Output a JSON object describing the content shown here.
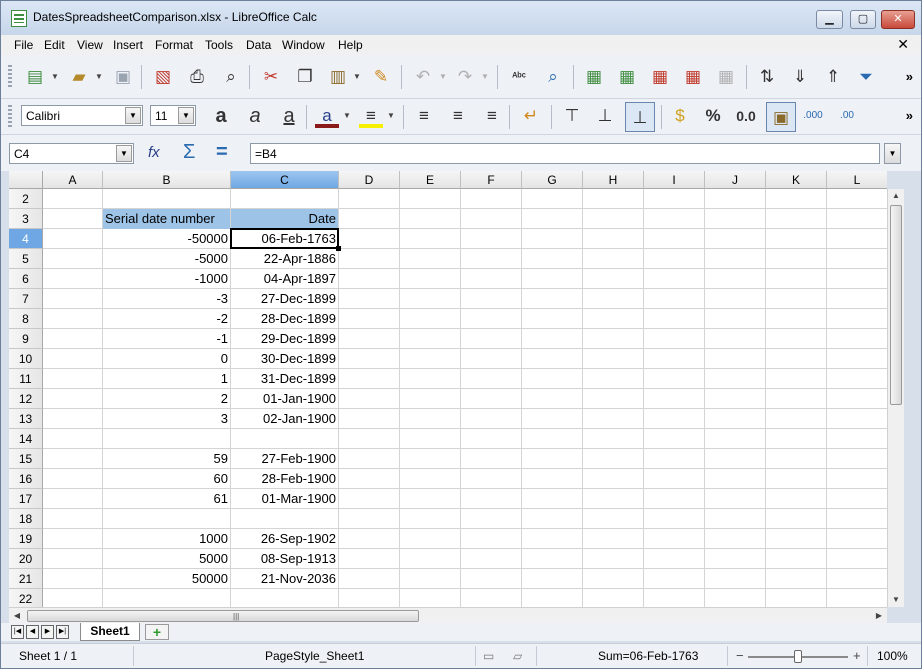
{
  "window": {
    "title": "DatesSpreadsheetComparison.xlsx - LibreOffice Calc",
    "minimize": "▁",
    "maximize": "▢",
    "close": "✕"
  },
  "menu": [
    "File",
    "Edit",
    "View",
    "Insert",
    "Format",
    "Tools",
    "Data",
    "Window",
    "Help"
  ],
  "menu_close": "✕",
  "toolbar": {
    "font_name": "Calibri",
    "font_size": "11",
    "more": "»"
  },
  "formula_bar": {
    "cell_ref": "C4",
    "formula": "=B4",
    "function_wizard_icon": "fx",
    "sum_icon": "Σ",
    "equals_icon": "="
  },
  "columns": [
    "A",
    "B",
    "C",
    "D",
    "E",
    "F",
    "G",
    "H",
    "I",
    "J",
    "K",
    "L"
  ],
  "rows": [
    "2",
    "3",
    "4",
    "5",
    "6",
    "7",
    "8",
    "9",
    "10",
    "11",
    "12",
    "13",
    "14",
    "15",
    "16",
    "17",
    "18",
    "19",
    "20",
    "21",
    "22"
  ],
  "selected_cell": "C4",
  "table": {
    "header_b": "Serial date number",
    "header_c": "Date",
    "data": [
      {
        "row": "4",
        "serial": "-50000",
        "date": "06-Feb-1763"
      },
      {
        "row": "5",
        "serial": "-5000",
        "date": "22-Apr-1886"
      },
      {
        "row": "6",
        "serial": "-1000",
        "date": "04-Apr-1897"
      },
      {
        "row": "7",
        "serial": "-3",
        "date": "27-Dec-1899"
      },
      {
        "row": "8",
        "serial": "-2",
        "date": "28-Dec-1899"
      },
      {
        "row": "9",
        "serial": "-1",
        "date": "29-Dec-1899"
      },
      {
        "row": "10",
        "serial": "0",
        "date": "30-Dec-1899"
      },
      {
        "row": "11",
        "serial": "1",
        "date": "31-Dec-1899"
      },
      {
        "row": "12",
        "serial": "2",
        "date": "01-Jan-1900"
      },
      {
        "row": "13",
        "serial": "3",
        "date": "02-Jan-1900"
      },
      {
        "row": "15",
        "serial": "59",
        "date": "27-Feb-1900"
      },
      {
        "row": "16",
        "serial": "60",
        "date": "28-Feb-1900"
      },
      {
        "row": "17",
        "serial": "61",
        "date": "01-Mar-1900"
      },
      {
        "row": "19",
        "serial": "1000",
        "date": "26-Sep-1902"
      },
      {
        "row": "20",
        "serial": "5000",
        "date": "08-Sep-1913"
      },
      {
        "row": "21",
        "serial": "50000",
        "date": "21-Nov-2036"
      }
    ]
  },
  "sheet_tabs": [
    "Sheet1"
  ],
  "add_sheet": "+",
  "status": {
    "sheet": "Sheet 1 / 1",
    "page_style": "PageStyle_Sheet1",
    "sum": "Sum=06-Feb-1763",
    "zoom": "100%",
    "zoom_out": "−",
    "zoom_in": "+"
  }
}
